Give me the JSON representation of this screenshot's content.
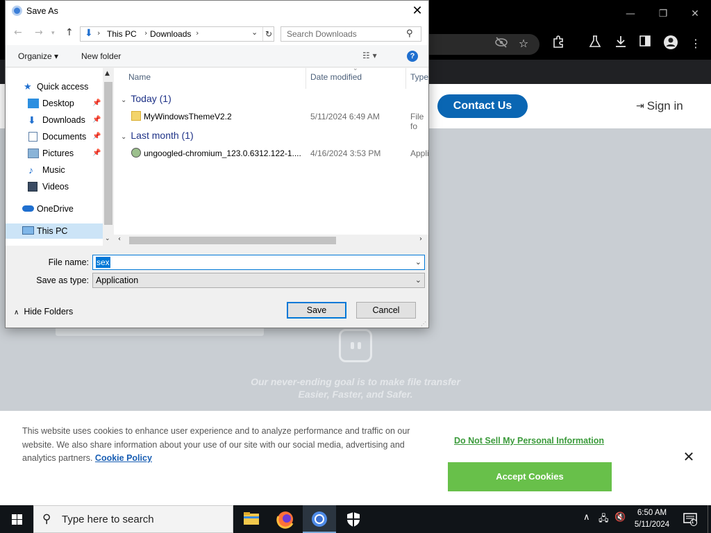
{
  "browser": {
    "window_controls": {
      "minimize": "—",
      "restore": "❐",
      "close": "✕"
    },
    "toolbar_icons": [
      "eye-off-icon",
      "star-icon",
      "extensions-icon",
      "labs-icon",
      "download-icon",
      "side-panel-icon",
      "profile-icon",
      "menu-icon"
    ]
  },
  "website": {
    "contact_button": "Contact Us",
    "sign_in": "Sign in",
    "tagline": "Our never-ending goal is to make file transfer Easier, Faster, and Safer."
  },
  "cookie_banner": {
    "text": "This website uses cookies to enhance user experience and to analyze performance and traffic on our website. We also share information about your use of our site with our social media, advertising and analytics partners.",
    "policy_link": "Cookie Policy",
    "do_not_sell": "Do Not Sell My Personal Information",
    "accept": "Accept Cookies",
    "close": "✕",
    "accent_color": "#68c04a"
  },
  "dialog": {
    "title": "Save As",
    "close": "✕",
    "address": {
      "crumbs": [
        "This PC",
        "Downloads"
      ]
    },
    "search_placeholder": "Search Downloads",
    "organize": "Organize ▾",
    "new_folder": "New folder",
    "help": "?",
    "nav": [
      {
        "label": "Quick access",
        "icon": "star-icon",
        "pinned": false,
        "selected": false
      },
      {
        "label": "Desktop",
        "icon": "desktop-icon",
        "pinned": true,
        "selected": false
      },
      {
        "label": "Downloads",
        "icon": "downloads-icon",
        "pinned": true,
        "selected": false
      },
      {
        "label": "Documents",
        "icon": "documents-icon",
        "pinned": true,
        "selected": false
      },
      {
        "label": "Pictures",
        "icon": "pictures-icon",
        "pinned": true,
        "selected": false
      },
      {
        "label": "Music",
        "icon": "music-icon",
        "pinned": false,
        "selected": false
      },
      {
        "label": "Videos",
        "icon": "videos-icon",
        "pinned": false,
        "selected": false
      },
      {
        "label": "OneDrive",
        "icon": "onedrive-icon",
        "pinned": false,
        "selected": false
      },
      {
        "label": "This PC",
        "icon": "computer-icon",
        "pinned": false,
        "selected": true
      }
    ],
    "columns": {
      "name": "Name",
      "date": "Date modified",
      "type": "Type"
    },
    "groups": [
      {
        "label": "Today (1)",
        "files": [
          {
            "name": "MyWindowsThemeV2.2",
            "date": "5/11/2024 6:49 AM",
            "type": "File fo",
            "icon": "folder-icon"
          }
        ]
      },
      {
        "label": "Last month (1)",
        "files": [
          {
            "name": "ungoogled-chromium_123.0.6312.122-1....",
            "date": "4/16/2024 3:53 PM",
            "type": "Appli",
            "icon": "installer-icon"
          }
        ]
      }
    ],
    "file_name_label": "File name:",
    "file_name_value": "sex",
    "save_type_label": "Save as type:",
    "save_type_value": "Application",
    "hide_folders": "Hide Folders",
    "save": "Save",
    "cancel": "Cancel"
  },
  "taskbar": {
    "search_placeholder": "Type here to search",
    "apps": [
      "file-explorer-icon",
      "firefox-icon",
      "chrome-icon",
      "security-icon"
    ],
    "time": "6:50 AM",
    "date": "5/11/2024",
    "notification_count": "1"
  }
}
